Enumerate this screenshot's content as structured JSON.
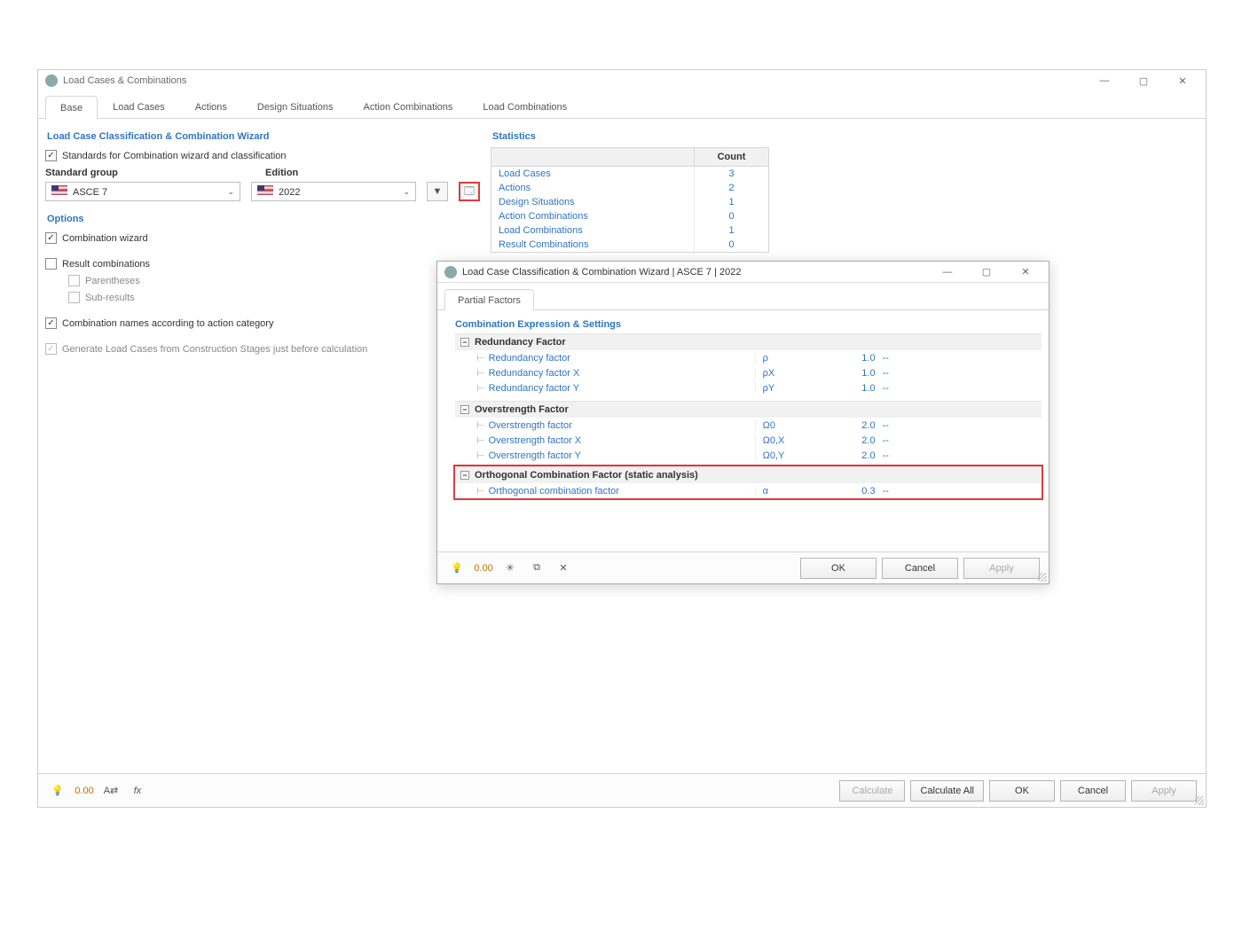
{
  "main_window": {
    "title": "Load Cases & Combinations",
    "tabs": [
      "Base",
      "Load Cases",
      "Actions",
      "Design Situations",
      "Action Combinations",
      "Load Combinations"
    ],
    "active_tab": 0
  },
  "wizard": {
    "section_title": "Load Case Classification & Combination Wizard",
    "standards_label": "Standards for Combination wizard and classification",
    "std_group_label": "Standard group",
    "edition_label": "Edition",
    "std_group_value": "ASCE 7",
    "edition_value": "2022"
  },
  "options": {
    "section_title": "Options",
    "combination_wizard": "Combination wizard",
    "result_combinations": "Result combinations",
    "parentheses": "Parentheses",
    "sub_results": "Sub-results",
    "names_by_category": "Combination names according to action category",
    "gen_from_stages": "Generate Load Cases from Construction Stages just before calculation"
  },
  "statistics": {
    "title": "Statistics",
    "count_header": "Count",
    "rows": [
      {
        "label": "Load Cases",
        "count": "3"
      },
      {
        "label": "Actions",
        "count": "2"
      },
      {
        "label": "Design Situations",
        "count": "1"
      },
      {
        "label": "Action Combinations",
        "count": "0"
      },
      {
        "label": "Load Combinations",
        "count": "1"
      },
      {
        "label": "Result Combinations",
        "count": "0"
      }
    ]
  },
  "sub_window": {
    "title": "Load Case Classification & Combination Wizard | ASCE 7 | 2022",
    "tab": "Partial Factors",
    "sec_title": "Combination Expression & Settings",
    "groups": [
      {
        "name": "Redundancy Factor",
        "rows": [
          {
            "name": "Redundancy factor",
            "sym": "ρ",
            "val": "1.0",
            "unit": "--"
          },
          {
            "name": "Redundancy factor X",
            "sym": "ρX",
            "val": "1.0",
            "unit": "--"
          },
          {
            "name": "Redundancy factor Y",
            "sym": "ρY",
            "val": "1.0",
            "unit": "--"
          }
        ]
      },
      {
        "name": "Overstrength Factor",
        "rows": [
          {
            "name": "Overstrength factor",
            "sym": "Ω0",
            "val": "2.0",
            "unit": "--"
          },
          {
            "name": "Overstrength factor X",
            "sym": "Ω0,X",
            "val": "2.0",
            "unit": "--"
          },
          {
            "name": "Overstrength factor Y",
            "sym": "Ω0,Y",
            "val": "2.0",
            "unit": "--"
          }
        ]
      },
      {
        "name": "Orthogonal Combination Factor (static analysis)",
        "highlight": true,
        "rows": [
          {
            "name": "Orthogonal combination factor",
            "sym": "α",
            "val": "0.3",
            "unit": "--"
          }
        ]
      }
    ],
    "buttons": {
      "ok": "OK",
      "cancel": "Cancel",
      "apply": "Apply"
    }
  },
  "footer": {
    "calculate": "Calculate",
    "calculate_all": "Calculate All",
    "ok": "OK",
    "cancel": "Cancel",
    "apply": "Apply"
  }
}
